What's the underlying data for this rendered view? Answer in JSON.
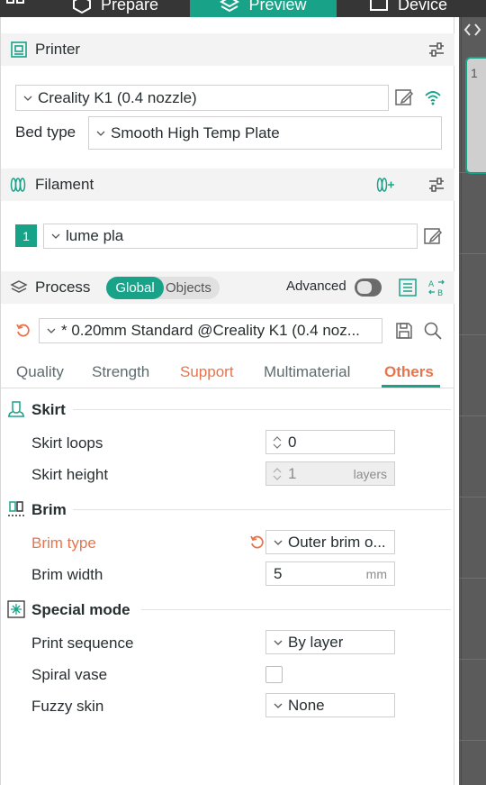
{
  "topbar": {
    "tabs": [
      {
        "label": "Prepare"
      },
      {
        "label": "Preview"
      },
      {
        "label": "Device"
      }
    ]
  },
  "printer": {
    "title": "Printer",
    "selected": "Creality K1 (0.4 nozzle)",
    "bed_type_label": "Bed type",
    "bed_type": "Smooth High Temp Plate"
  },
  "filament": {
    "title": "Filament",
    "slot_number": "1",
    "slot_color": "#18a389",
    "selected": "lume pla"
  },
  "process": {
    "title": "Process",
    "scope_global": "Global",
    "scope_objects": "Objects",
    "advanced_label": "Advanced",
    "advanced_on": false,
    "preset": "* 0.20mm Standard @Creality K1 (0.4 noz..."
  },
  "tabs": [
    {
      "label": "Quality"
    },
    {
      "label": "Strength"
    },
    {
      "label": "Support"
    },
    {
      "label": "Multimaterial"
    },
    {
      "label": "Others"
    }
  ],
  "groups": {
    "skirt": {
      "title": "Skirt",
      "loops_label": "Skirt loops",
      "loops_value": "0",
      "height_label": "Skirt height",
      "height_value": "1",
      "height_unit": "layers"
    },
    "brim": {
      "title": "Brim",
      "type_label": "Brim type",
      "type_value": "Outer brim o...",
      "width_label": "Brim width",
      "width_value": "5",
      "width_unit": "mm"
    },
    "special": {
      "title": "Special mode",
      "sequence_label": "Print sequence",
      "sequence_value": "By layer",
      "spiral_label": "Spiral vase",
      "spiral_checked": false,
      "fuzzy_label": "Fuzzy skin",
      "fuzzy_value": "None"
    }
  },
  "colors": {
    "accent": "#18a389",
    "changed": "#e8744b"
  },
  "canvas": {
    "plate_number": "1"
  }
}
